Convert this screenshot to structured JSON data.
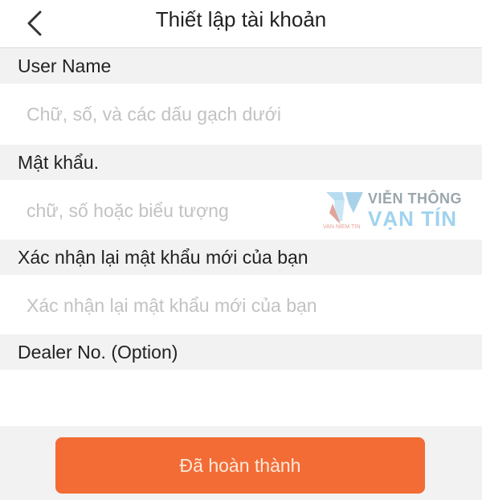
{
  "header": {
    "title": "Thiết lập tài khoản",
    "back_icon": "chevron-left-icon"
  },
  "fields": [
    {
      "label": "User Name",
      "placeholder": "Chữ, số, và các dấu gạch dưới",
      "value": ""
    },
    {
      "label": "Mật khẩu.",
      "placeholder": "chữ, số hoặc biểu tượng",
      "value": ""
    },
    {
      "label": "Xác nhận lại mật khẩu mới của bạn",
      "placeholder": "Xác nhận lại mật khẩu mới của bạn",
      "value": ""
    },
    {
      "label": "Dealer No. (Option)",
      "placeholder": "",
      "value": ""
    }
  ],
  "watermark": {
    "line1": "VIỄN THÔNG",
    "line2": "VẠN TÍN",
    "small": "VAN NIEM TIN"
  },
  "submit": {
    "label": "Đã hoàn thành"
  },
  "colors": {
    "accent": "#f36c35",
    "section_bg": "#f2f2f2",
    "placeholder": "#c2c2c2"
  }
}
